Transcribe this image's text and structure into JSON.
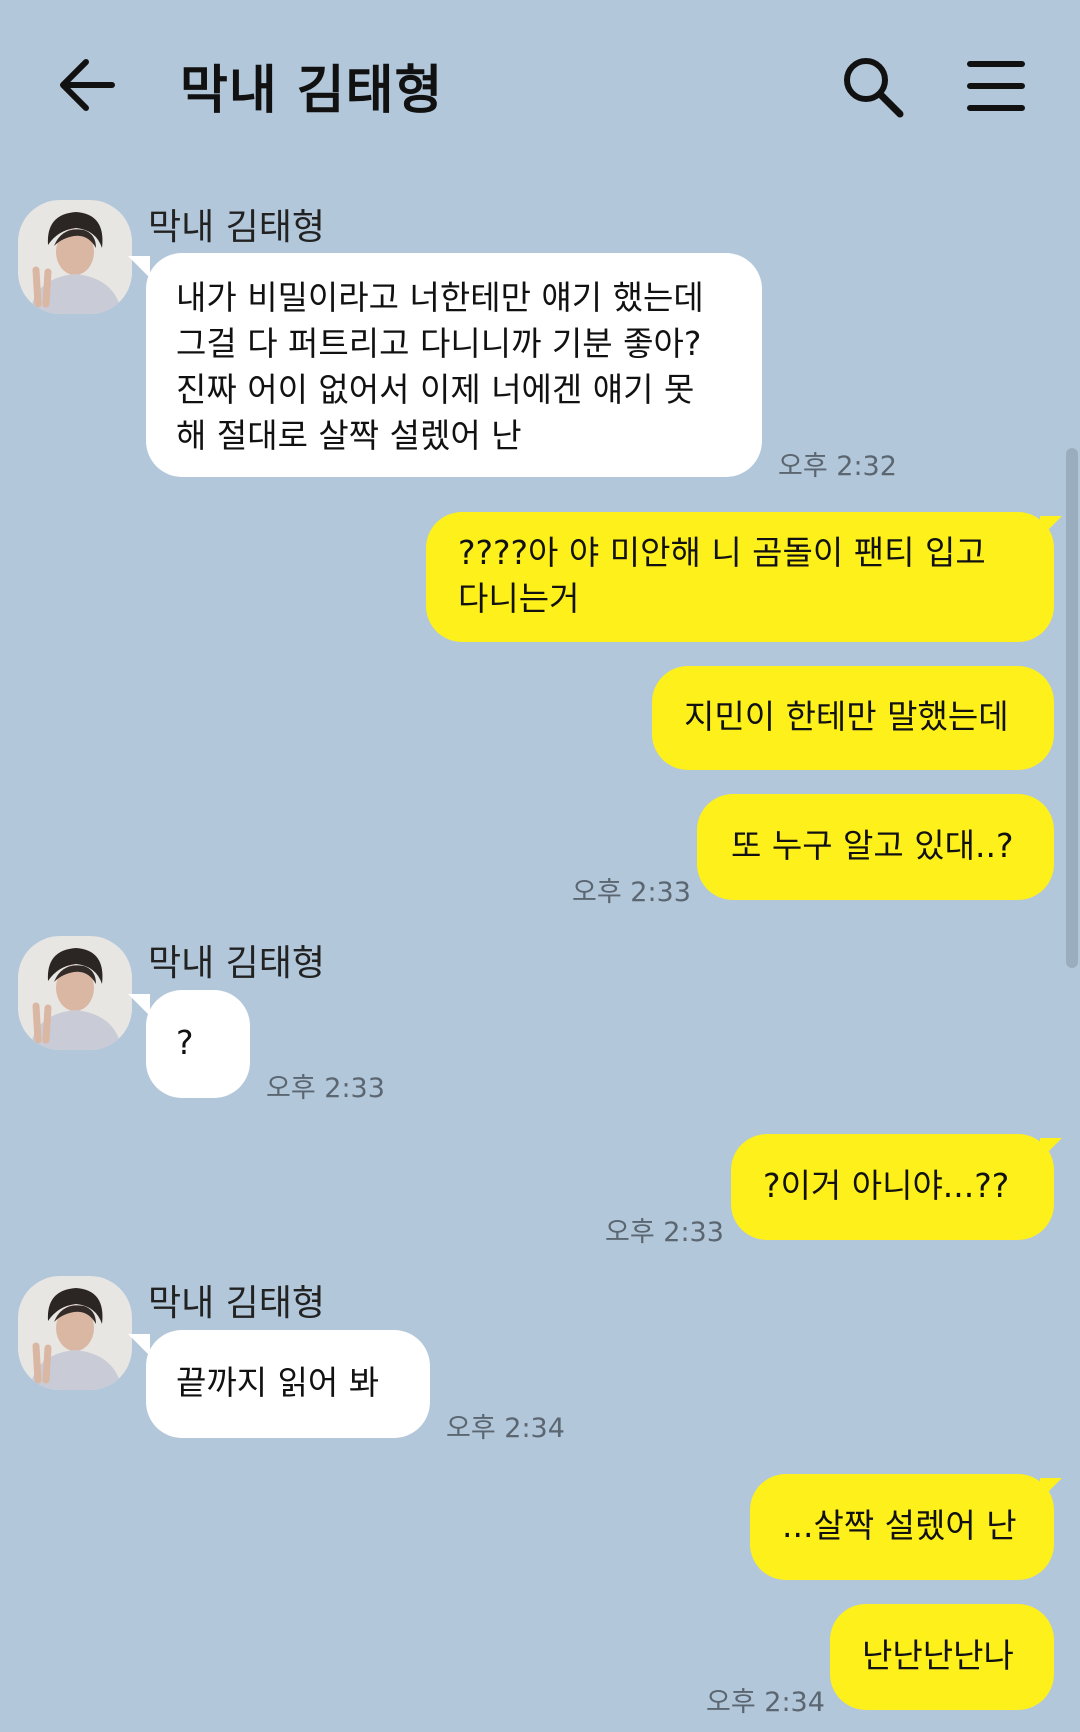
{
  "header": {
    "title": "막내 김태형",
    "back_icon": "arrow-left-icon",
    "search_icon": "search-icon",
    "menu_icon": "hamburger-menu-icon"
  },
  "colors": {
    "background": "#b2c7da",
    "incoming_bubble": "#ffffff",
    "outgoing_bubble": "#fef01b"
  },
  "messages": [
    {
      "direction": "incoming",
      "sender": "막내 김태형",
      "lines": [
        "내가 비밀이라고 너한테만 얘기 했는데",
        "그걸 다 퍼트리고 다니니까 기분 좋아?",
        "진짜 어이 없어서 이제 너에겐 얘기 못",
        "해 절대로 살짝 설렜어 난"
      ],
      "time": "오후 2:32"
    },
    {
      "direction": "outgoing",
      "lines": [
        "????아 야 미안해 니 곰돌이 팬티 입고",
        "다니는거"
      ]
    },
    {
      "direction": "outgoing",
      "lines": [
        "지민이 한테만 말했는데"
      ]
    },
    {
      "direction": "outgoing",
      "lines": [
        "또 누구 알고 있대..?"
      ],
      "time": "오후 2:33"
    },
    {
      "direction": "incoming",
      "sender": "막내 김태형",
      "lines": [
        "?"
      ],
      "time": "오후 2:33"
    },
    {
      "direction": "outgoing",
      "lines": [
        "?이거 아니야...??"
      ],
      "time": "오후 2:33"
    },
    {
      "direction": "incoming",
      "sender": "막내 김태형",
      "lines": [
        "끝까지  읽어 봐"
      ],
      "time": "오후 2:34"
    },
    {
      "direction": "outgoing",
      "lines": [
        "...살짝 설렜어 난"
      ]
    },
    {
      "direction": "outgoing",
      "lines": [
        "난난난난나"
      ],
      "time": "오후 2:34"
    }
  ]
}
